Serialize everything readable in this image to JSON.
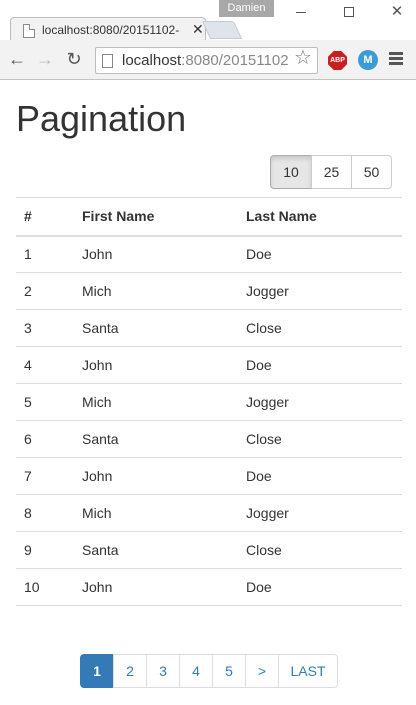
{
  "browser": {
    "profile_name": "Damien",
    "tab_title": "localhost:8080/20151102-",
    "url_host": "localhost",
    "url_rest": ":8080/20151102",
    "extension_abp_label": "ABP",
    "extension_other_label": "M"
  },
  "page": {
    "title": "Pagination",
    "page_size_options": [
      "10",
      "25",
      "50"
    ],
    "page_size_selected": "10",
    "table": {
      "headers": [
        "#",
        "First Name",
        "Last Name"
      ],
      "rows": [
        [
          "1",
          "John",
          "Doe"
        ],
        [
          "2",
          "Mich",
          "Jogger"
        ],
        [
          "3",
          "Santa",
          "Close"
        ],
        [
          "4",
          "John",
          "Doe"
        ],
        [
          "5",
          "Mich",
          "Jogger"
        ],
        [
          "6",
          "Santa",
          "Close"
        ],
        [
          "7",
          "John",
          "Doe"
        ],
        [
          "8",
          "Mich",
          "Jogger"
        ],
        [
          "9",
          "Santa",
          "Close"
        ],
        [
          "10",
          "John",
          "Doe"
        ]
      ]
    },
    "pagination": {
      "items": [
        "1",
        "2",
        "3",
        "4",
        "5",
        ">",
        "LAST"
      ],
      "active": "1"
    }
  },
  "colors": {
    "link": "#337ab7",
    "active_page_bg": "#337ab7",
    "border": "#dddddd",
    "abp_red": "#c7201e"
  }
}
